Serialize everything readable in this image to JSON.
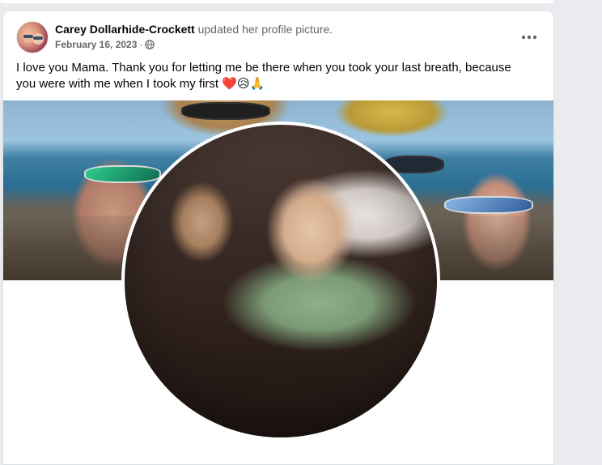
{
  "post": {
    "author": "Carey Dollarhide-Crockett",
    "action": "updated her profile picture.",
    "date": "February 16, 2023",
    "date_separator": "·",
    "privacy_icon": "globe-icon",
    "more_icon": "more-options-icon",
    "message": "I love you Mama. Thank you for letting me be there when you took your last breath, because you were with me when I took my first",
    "emojis": "❤️😥🙏"
  },
  "images": {
    "cover_photo": "cover-photo",
    "profile_picture": "profile-picture"
  },
  "colors": {
    "card_background": "#ffffff",
    "page_background": "#e9ebee",
    "primary_text": "#050505",
    "secondary_text": "#65676b"
  }
}
